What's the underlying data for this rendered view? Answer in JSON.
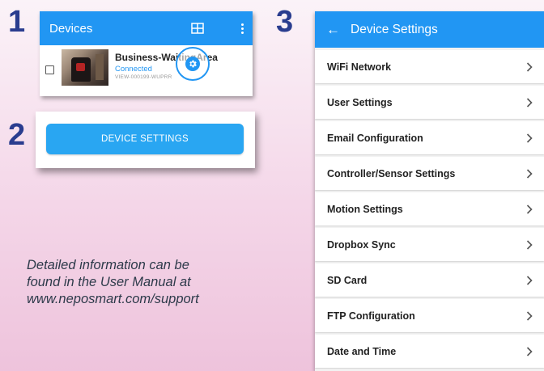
{
  "steps": {
    "one": "1",
    "two": "2",
    "three": "3"
  },
  "devices_panel": {
    "title": "Devices",
    "device": {
      "name": "Business-WaitingArea",
      "status": "Connected",
      "id": "VIEW-000199-WUPRR"
    },
    "icons": [
      "grid-view-icon",
      "more-vert-icon",
      "settings-gear-icon"
    ]
  },
  "device_settings_button": {
    "label": "DEVICE SETTINGS"
  },
  "info_text": {
    "line1": "Detailed information can be",
    "line2": "found in the User Manual at",
    "line3": "www.neposmart.com/support"
  },
  "settings_panel": {
    "back_icon": "←",
    "title": "Device Settings",
    "items": [
      {
        "label": "WiFi Network"
      },
      {
        "label": "User Settings"
      },
      {
        "label": "Email Configuration"
      },
      {
        "label": "Controller/Sensor Settings"
      },
      {
        "label": "Motion Settings"
      },
      {
        "label": "Dropbox Sync"
      },
      {
        "label": "SD Card"
      },
      {
        "label": "FTP Configuration"
      },
      {
        "label": "Date and Time"
      }
    ]
  },
  "colors": {
    "accent": "#2196f3",
    "button": "#29a6f2",
    "step_number": "#2a3d8f",
    "info_text": "#2d3a4a"
  }
}
